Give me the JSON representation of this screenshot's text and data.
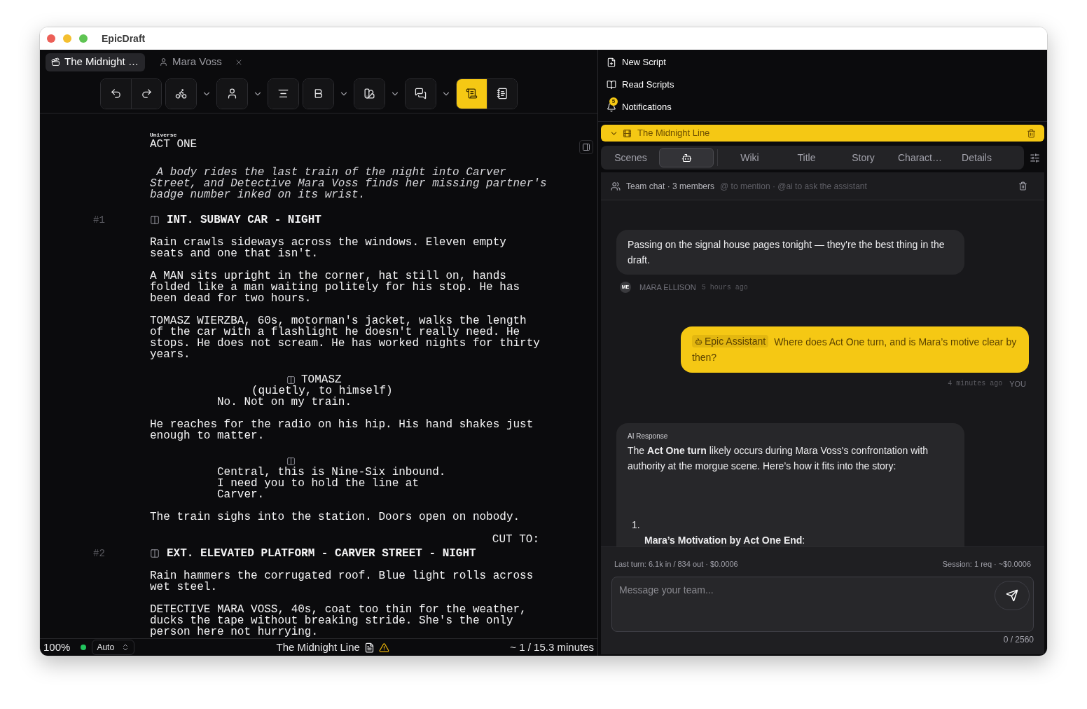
{
  "window": {
    "title": "EpicDraft"
  },
  "tabs": [
    {
      "kind": "script",
      "label": "The Midnight …",
      "selected": true,
      "closable": false
    },
    {
      "kind": "character",
      "label": "Mara Voss",
      "selected": false,
      "closable": true
    }
  ],
  "toolbar": {
    "groups": [
      {
        "dropdown": false,
        "buttons": [
          {
            "selected": false
          },
          {
            "selected": false
          }
        ]
      },
      {
        "dropdown": true,
        "buttons": [
          {
            "selected": false
          }
        ]
      },
      {
        "dropdown": true,
        "buttons": [
          {
            "selected": false
          }
        ]
      },
      {
        "dropdown": false,
        "buttons": [
          {
            "selected": false
          }
        ]
      },
      {
        "dropdown": true,
        "buttons": [
          {
            "selected": false
          }
        ]
      },
      {
        "dropdown": true,
        "buttons": [
          {
            "selected": false
          }
        ]
      },
      {
        "dropdown": true,
        "buttons": [
          {
            "selected": false
          }
        ]
      },
      {
        "dropdown": false,
        "buttons": [
          {
            "selected": true
          },
          {
            "selected": false
          }
        ]
      }
    ]
  },
  "script": {
    "elements": [
      {
        "kind": "label",
        "lines": [
          "Universe"
        ]
      },
      {
        "kind": "act",
        "lines": [
          "ACT ONE"
        ]
      },
      {
        "kind": "synopsis",
        "lines": [
          " A body rides the last train of the night into Carver",
          "Street, and Detective Mara Voss finds her missing partner's",
          "badge number inked on its wrist."
        ]
      },
      {
        "kind": "scene",
        "number": "#1",
        "lines": [
          "INT. SUBWAY CAR - NIGHT"
        ]
      },
      {
        "kind": "action",
        "lines": [
          "Rain crawls sideways across the windows. Eleven empty",
          "seats and one that isn't."
        ]
      },
      {
        "kind": "action",
        "lines": [
          "A MAN sits upright in the corner, hat still on, hands",
          "folded like a man waiting politely for his stop. He has",
          "been dead for two hours."
        ]
      },
      {
        "kind": "action",
        "lines": [
          "TOMASZ WIERZBA, 60s, motorman's jacket, walks the length",
          "of the car with a flashlight he doesn't really need. He",
          "stops. He does not scream. He has worked nights for thirty",
          "years."
        ]
      },
      {
        "kind": "character",
        "lines": [
          "TOMASZ"
        ]
      },
      {
        "kind": "parenthetical",
        "lines": [
          "(quietly, to himself)"
        ]
      },
      {
        "kind": "dialogue",
        "lines": [
          "No. Not on my train."
        ]
      },
      {
        "kind": "action",
        "lines": [
          "He reaches for the radio on his hip. His hand shakes just",
          "enough to matter."
        ]
      },
      {
        "kind": "character"
      },
      {
        "kind": "dialogue",
        "lines": [
          "Central, this is Nine-Six inbound.",
          "I need you to hold the line at",
          "Carver."
        ]
      },
      {
        "kind": "action",
        "lines": [
          "The train sighs into the station. Doors open on nobody."
        ]
      },
      {
        "kind": "transition",
        "lines": [
          "CUT TO:"
        ]
      },
      {
        "kind": "scene",
        "number": "#2",
        "lines": [
          "EXT. ELEVATED PLATFORM - CARVER STREET - NIGHT"
        ]
      },
      {
        "kind": "action",
        "lines": [
          "Rain hammers the corrugated roof. Blue light rolls across",
          "wet steel."
        ]
      },
      {
        "kind": "action",
        "lines": [
          "DETECTIVE MARA VOSS, 40s, coat too thin for the weather,",
          "ducks the tape without breaking stride. She's the only",
          "person here not hurrying."
        ]
      }
    ]
  },
  "status_bar": {
    "zoom": "100%",
    "connected": true,
    "mode": "Auto",
    "title": "The Midnight Line",
    "warning": true,
    "duration": "~ 1 / 15.3 minutes"
  },
  "nav": [
    {
      "label": "New Script"
    },
    {
      "label": "Read Scripts"
    },
    {
      "label": "Notifications",
      "badge": "5"
    }
  ],
  "project": {
    "title": "The Midnight Line",
    "expanded": true
  },
  "project_tabs": [
    {
      "kind": "text",
      "label": "Scenes",
      "selected": false
    },
    {
      "kind": "assistant",
      "selected": true
    },
    {
      "kind": "text",
      "label": "Wiki",
      "selected": false
    },
    {
      "kind": "text",
      "label": "Title",
      "selected": false
    },
    {
      "kind": "text",
      "label": "Story",
      "selected": false
    },
    {
      "kind": "text",
      "label": "Charact…",
      "selected": false
    },
    {
      "kind": "text",
      "label": "Details",
      "selected": false
    }
  ],
  "chat": {
    "title": "Team chat · 3 members",
    "hint": "@ to mention · @ai to ask the assistant",
    "messages": [
      {
        "kind": "member",
        "text": "Passing on the signal house pages tonight — they're the best thing in the draft.",
        "initials": "ME",
        "author": "MARA ELLISON",
        "time": "5 hours ago"
      },
      {
        "kind": "own",
        "mention": "Epic Assistant",
        "text": "Where does Act One turn, and is Mara’s motive clear by then?",
        "time": "4 minutes ago",
        "author": "YOU"
      },
      {
        "kind": "ai",
        "label": "AI Response",
        "text": "The **Act One turn** likely occurs during Mara Voss's confrontation with authority at the morgue scene. Here’s how it fits into the story:",
        "list": [
          {
            "number": "1.",
            "text": "**Mara’s Motivation by Act One End**:"
          }
        ]
      }
    ],
    "usage": {
      "last_turn": "Last turn: 6.1k in / 834 out · $0.0006",
      "session": "Session: 1 req · ~$0.0006"
    },
    "input": {
      "placeholder": "Message your team..."
    },
    "counter": "0 / 2560"
  }
}
